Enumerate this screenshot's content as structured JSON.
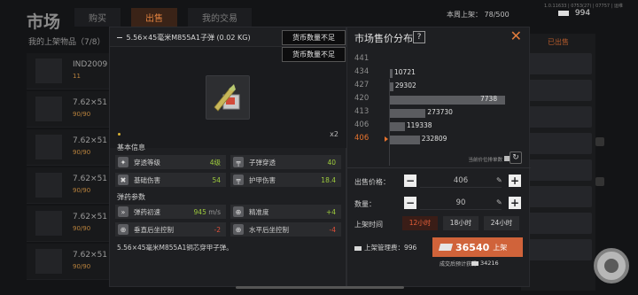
{
  "background": {
    "title": "市场",
    "tabs": [
      "购买",
      "出售",
      "我的交易"
    ],
    "active_tab": 1,
    "weekly": "本周上架：",
    "weekly_count": "78/500",
    "info_text": "1.0.11633 | 0753(27) | 07757 | 运维",
    "money": "994",
    "my_listings": "我的上架物品（7/8）",
    "rows": [
      {
        "title": "IND2009",
        "sub": "11"
      },
      {
        "title": "7.62×51",
        "sub": "90/90"
      },
      {
        "title": "7.62×51",
        "sub": "90/90"
      },
      {
        "title": "7.62×51",
        "sub": "90/90"
      },
      {
        "title": "7.62×51",
        "sub": "90/90"
      },
      {
        "title": "7.62×51",
        "sub": "90/90"
      }
    ],
    "right_header": "已出售"
  },
  "detail": {
    "title": "5.56×45毫米M855A1子弹 (0.02 KG)",
    "count": "x2",
    "basic_label": "基本信息",
    "basic": [
      {
        "name": "穿透等级",
        "value": "4级"
      },
      {
        "name": "子弹穿透",
        "value": "40"
      },
      {
        "name": "基础伤害",
        "value": "54"
      },
      {
        "name": "护甲伤害",
        "value": "18.4"
      }
    ],
    "ammo_label": "弹药参数",
    "ammo": [
      {
        "name": "弹药初速",
        "value": "945",
        "unit": "m/s"
      },
      {
        "name": "精准度",
        "value": "+4"
      },
      {
        "name": "垂直后坐控制",
        "value": "-2"
      },
      {
        "name": "水平后坐控制",
        "value": "-4"
      }
    ],
    "description": "5.56×45毫米M855A1铜芯穿甲子弹。"
  },
  "tooltip": [
    "货币数量不足",
    "货币数量不足"
  ],
  "dist": {
    "title": "市场售价分布",
    "help": "?",
    "rows": [
      {
        "price": "441",
        "qty": "",
        "bar": 0
      },
      {
        "price": "434",
        "qty": "10721",
        "bar": 0.02
      },
      {
        "price": "427",
        "qty": "29302",
        "bar": 0.03
      },
      {
        "price": "420",
        "qty": "7738",
        "bar": 1.0
      },
      {
        "price": "413",
        "qty": "273730",
        "bar": 0.31
      },
      {
        "price": "406",
        "qty": "119338",
        "bar": 0.13
      },
      {
        "price": "406",
        "qty": "232809",
        "bar": 0.26
      }
    ],
    "hint": "当前价位排单数",
    "price_label": "出售价格：",
    "price_value": "406",
    "qty_label": "数量：",
    "qty_value": "90",
    "time_label": "上架时间",
    "times": [
      "12小时",
      "18小时",
      "24小时"
    ],
    "active_time": 0,
    "fee_label": "上架管理费：",
    "fee_value": "996",
    "button_amount": "36540",
    "button_label": "上架",
    "expect_label": "成交后预计获得",
    "expect_value": "34216"
  }
}
